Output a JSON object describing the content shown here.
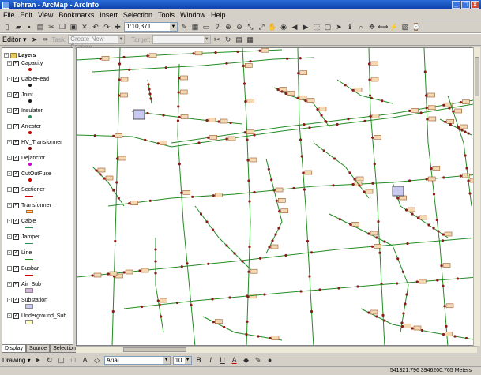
{
  "window": {
    "title": "Tehran - ArcMap - ArcInfo"
  },
  "menu": [
    "File",
    "Edit",
    "View",
    "Bookmarks",
    "Insert",
    "Selection",
    "Tools",
    "Window",
    "Help"
  ],
  "toolbar": {
    "scale_value": "1:10,371"
  },
  "editor": {
    "label": "Editor ▾",
    "task_label": "Task:",
    "task_value": "Create New Feature",
    "target_label": "Target:",
    "target_value": ""
  },
  "toc": {
    "root": "Layers",
    "layers": [
      {
        "label": "Capacity",
        "symbol": "dot",
        "color": "#cc0000"
      },
      {
        "label": "CableHead",
        "symbol": "dot",
        "color": "#1a1a1a"
      },
      {
        "label": "Joint",
        "symbol": "dot",
        "color": "#1a1a1a"
      },
      {
        "label": "Insulator",
        "symbol": "dot",
        "color": "#2e8b57"
      },
      {
        "label": "Arrester",
        "symbol": "dot",
        "color": "#cc0000"
      },
      {
        "label": "HV_Transformer",
        "symbol": "dot",
        "color": "#8b0000"
      },
      {
        "label": "Dejanctor",
        "symbol": "dot",
        "color": "#cc00cc"
      },
      {
        "label": "CutOutFuse",
        "symbol": "dot",
        "color": "#cc0000"
      },
      {
        "label": "Sectioner",
        "symbol": "line",
        "color": "#cc0000"
      },
      {
        "label": "Transformer",
        "symbol": "box",
        "color": "#cc6600"
      },
      {
        "label": "Cable",
        "symbol": "line",
        "color": "#2e8b57"
      },
      {
        "label": "Jamper",
        "symbol": "line",
        "color": "#2e8b57"
      },
      {
        "label": "Line",
        "symbol": "line",
        "color": "#228b22"
      },
      {
        "label": "Busbar",
        "symbol": "line",
        "color": "#cc0000"
      },
      {
        "label": "Air_Sub",
        "symbol": "rect",
        "color": "#d8b4e2"
      },
      {
        "label": "Substation",
        "symbol": "rect",
        "color": "#c8c8f0"
      },
      {
        "label": "Underground_Sub",
        "symbol": "rect",
        "color": "#ffffc8"
      }
    ],
    "tabs": [
      "Display",
      "Source",
      "Selection"
    ]
  },
  "drawing": {
    "label": "Drawing ▾",
    "font": "Arial",
    "size": "10",
    "bold": "B",
    "italic": "I",
    "underline": "U",
    "text_color": "A"
  },
  "status": {
    "coords": "541321.796  3946200.765 Meters"
  },
  "colors": {
    "line": "#228b22",
    "node": "#8b1a1a",
    "label_fill": "#f4d8b4",
    "title_bar": "#0a3fa8"
  }
}
